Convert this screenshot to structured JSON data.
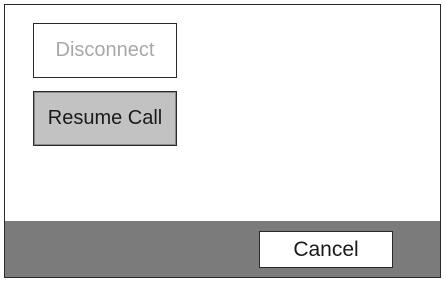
{
  "dialog": {
    "disconnect_label": "Disconnect",
    "resume_call_label": "Resume Call",
    "cancel_label": "Cancel"
  }
}
